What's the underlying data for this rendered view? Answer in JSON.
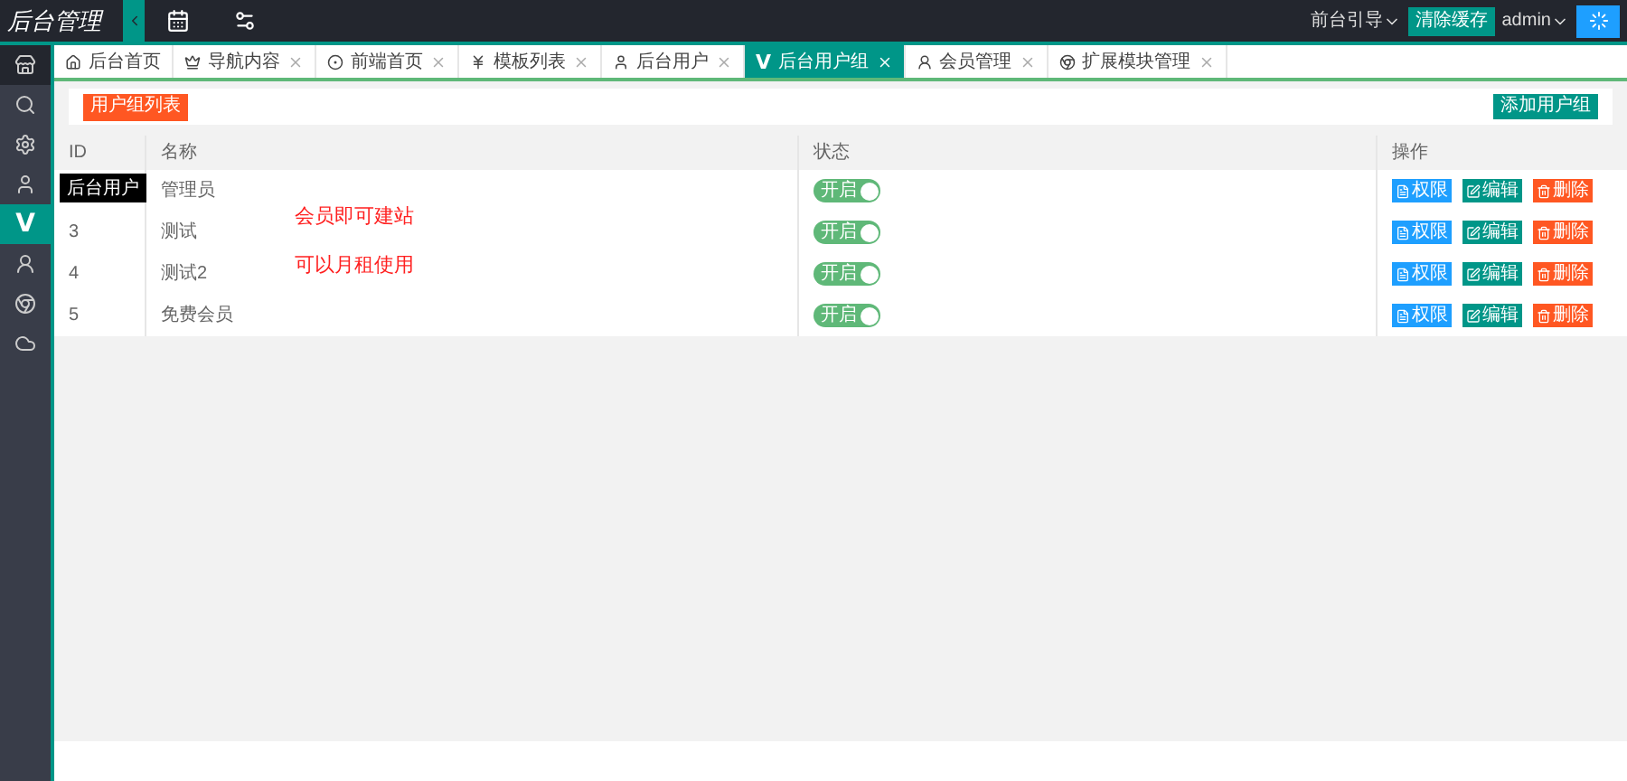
{
  "header": {
    "logo": "后台管理",
    "links": [
      {
        "label": "前台引导",
        "kind": "dropdown"
      },
      {
        "label": "清除缓存",
        "kind": "button"
      },
      {
        "label": "admin",
        "kind": "dropdown"
      }
    ]
  },
  "sidebar": {
    "items": [
      {
        "selected": false
      },
      {
        "selected": false
      },
      {
        "selected": false
      },
      {
        "selected": false
      },
      {
        "glyph": "V",
        "selected": true
      },
      {
        "selected": false
      },
      {
        "selected": false
      },
      {
        "selected": false
      }
    ],
    "tooltip": "后台用户"
  },
  "tabs": [
    {
      "label": "后台首页",
      "closable": false,
      "selected": false
    },
    {
      "label": "导航内容",
      "closable": true,
      "selected": false
    },
    {
      "label": "前端首页",
      "closable": true,
      "selected": false
    },
    {
      "label": "模板列表",
      "closable": true,
      "selected": false
    },
    {
      "label": "后台用户",
      "closable": true,
      "selected": false
    },
    {
      "label": "后台用户组",
      "glyph": "V",
      "closable": true,
      "selected": true
    },
    {
      "label": "会员管理",
      "closable": true,
      "selected": false
    },
    {
      "label": "扩展模块管理",
      "closable": true,
      "selected": false
    }
  ],
  "toolbar": {
    "list_button": "用户组列表",
    "add_button": "添加用户组"
  },
  "table": {
    "columns": [
      "ID",
      "名称",
      "状态",
      "操作"
    ],
    "rows": [
      {
        "id": "",
        "name": "管理员",
        "status": {
          "label": "开启",
          "on": true
        },
        "actions": [
          {
            "label": "权限",
            "kind": "perm"
          },
          {
            "label": "编辑",
            "kind": "edit"
          },
          {
            "label": "删除",
            "kind": "delete"
          }
        ]
      },
      {
        "id": "3",
        "name": "测试",
        "status": {
          "label": "开启",
          "on": true
        },
        "actions": [
          {
            "label": "权限",
            "kind": "perm"
          },
          {
            "label": "编辑",
            "kind": "edit"
          },
          {
            "label": "删除",
            "kind": "delete"
          }
        ]
      },
      {
        "id": "4",
        "name": "测试2",
        "status": {
          "label": "开启",
          "on": true
        },
        "actions": [
          {
            "label": "权限",
            "kind": "perm"
          },
          {
            "label": "编辑",
            "kind": "edit"
          },
          {
            "label": "删除",
            "kind": "delete"
          }
        ]
      },
      {
        "id": "5",
        "name": "免费会员",
        "status": {
          "label": "开启",
          "on": true
        },
        "actions": [
          {
            "label": "权限",
            "kind": "perm"
          },
          {
            "label": "编辑",
            "kind": "edit"
          },
          {
            "label": "删除",
            "kind": "delete"
          }
        ]
      }
    ]
  },
  "overlay_notes": [
    "会员即可建站",
    "可以月租使用"
  ]
}
